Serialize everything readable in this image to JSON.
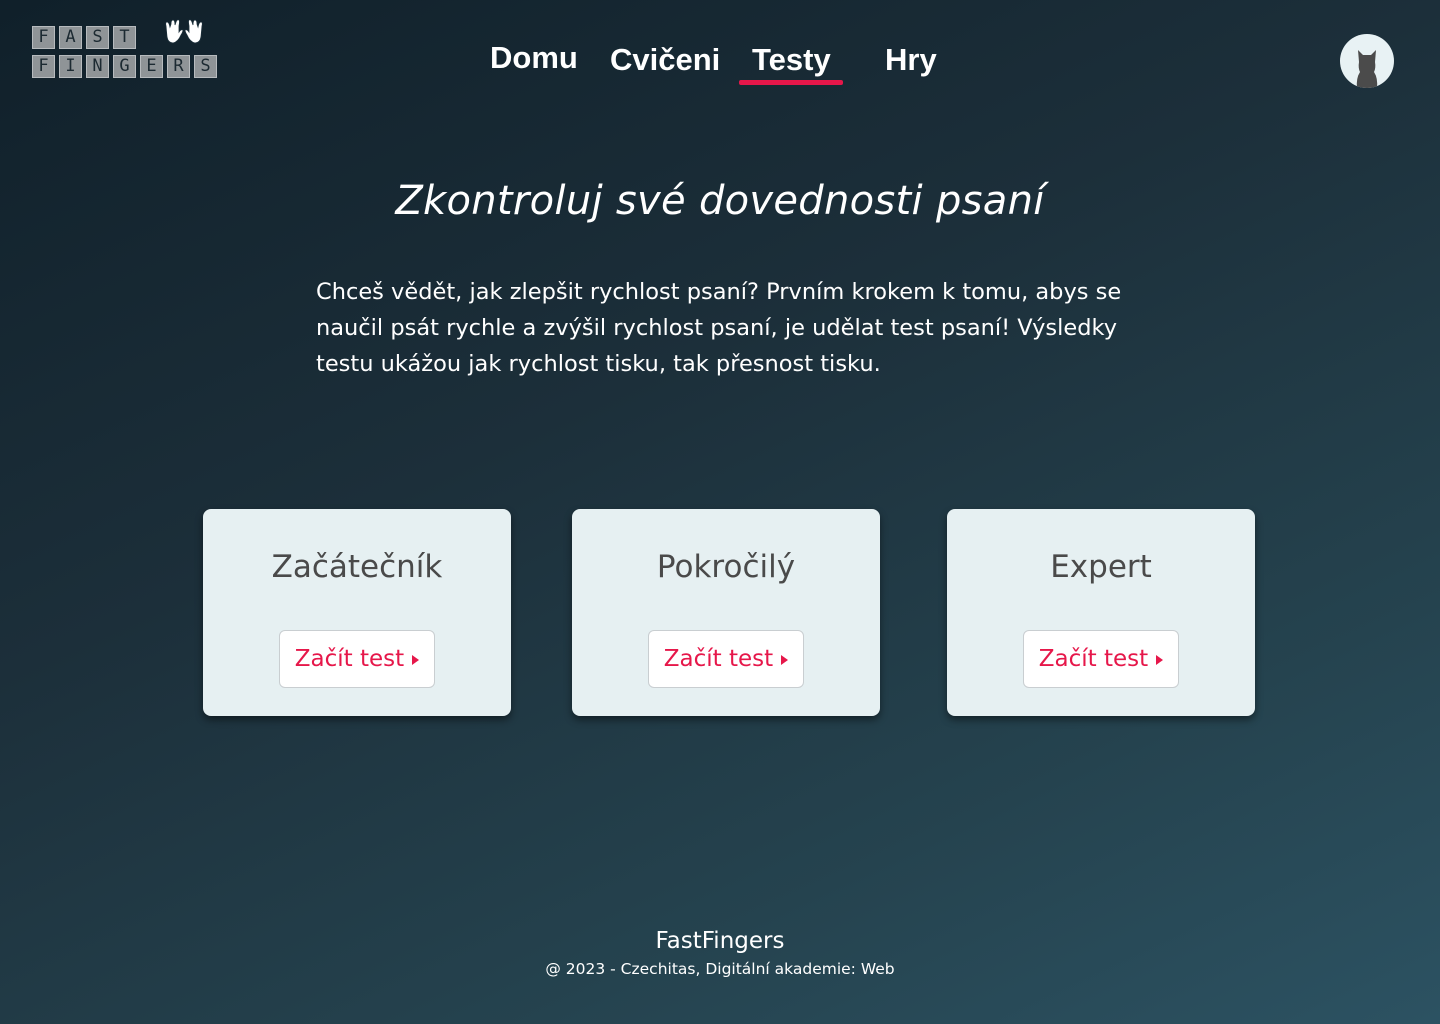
{
  "header": {
    "logo": {
      "row1": [
        "F",
        "A",
        "S",
        "T"
      ],
      "row2": [
        "F",
        "I",
        "N",
        "G",
        "E",
        "R",
        "S"
      ],
      "hands_icon": "waving-hands-icon"
    },
    "nav": {
      "items": [
        {
          "label": "Domu"
        },
        {
          "label": "Cvičeni"
        },
        {
          "label": "Testy",
          "active": true
        },
        {
          "label": "Hry"
        }
      ],
      "active_color": "#e6174a"
    },
    "avatar_icon": "cat-avatar-icon"
  },
  "main": {
    "headline": "Zkontroluj své dovednosti psaní",
    "intro": "Chceš vědět, jak zlepšit rychlost psaní? Prvním krokem k tomu, abys se naučil psát rychle a zvýšil rychlost psaní, je udělat test psaní! Výsledky testu ukážou jak rychlost tisku, tak přesnost tisku.",
    "cards": [
      {
        "title": "Začátečník",
        "button": "Začít test"
      },
      {
        "title": "Pokročilý",
        "button": "Začít test"
      },
      {
        "title": "Expert",
        "button": "Začít test"
      }
    ]
  },
  "footer": {
    "title": "FastFingers",
    "copyright": "@ 2023 - Czechitas, Digitální akademie: Web"
  },
  "colors": {
    "accent": "#e6174a",
    "card_bg": "#e6f0f2"
  }
}
